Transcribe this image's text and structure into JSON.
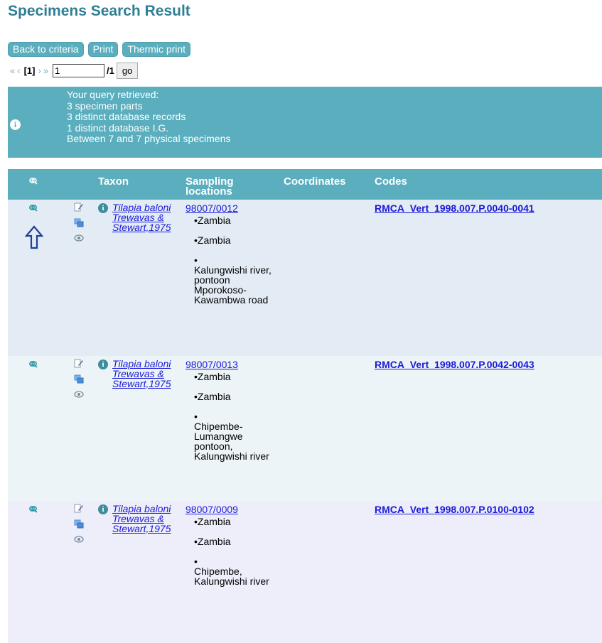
{
  "page": {
    "title": "Specimens Search Result"
  },
  "toolbar": {
    "back_label": "Back to criteria",
    "print_label": "Print",
    "thermic_label": "Thermic print"
  },
  "pager": {
    "first": "«",
    "prev": "‹",
    "current": "[1]",
    "next": "›",
    "last": "»",
    "page_input": "1",
    "total": "/1",
    "go_label": "go"
  },
  "info": {
    "line1": "Your query retrieved:",
    "line2": "3 specimen parts",
    "line3": "3 distinct database records",
    "line4": "1 distinct database I.G.",
    "line5": "Between 7 and 7 physical specimens"
  },
  "table": {
    "headers": {
      "taxon": "Taxon",
      "sampling": "Sampling locations",
      "coordinates": "Coordinates",
      "codes": "Codes"
    },
    "rows": [
      {
        "taxon": "Tilapia baloni Trewavas & Stewart,1975",
        "ig": "98007/0012",
        "loc1": "Zambia",
        "loc2": "Zambia",
        "loc3": "Kalungwishi river, pontoon Mporokoso-Kawambwa road",
        "code": "RMCA_Vert_1998.007.P.0040-0041"
      },
      {
        "taxon": "Tilapia baloni Trewavas & Stewart,1975",
        "ig": "98007/0013",
        "loc1": "Zambia",
        "loc2": "Zambia",
        "loc3": "Chipembe-Lumangwe pontoon, Kalungwishi river",
        "code": "RMCA_Vert_1998.007.P.0042-0043"
      },
      {
        "taxon": "Tilapia baloni Trewavas & Stewart,1975",
        "ig": "98007/0009",
        "loc1": "Zambia",
        "loc2": "Zambia",
        "loc3": "Chipembe, Kalungwishi river",
        "code": "RMCA_Vert_1998.007.P.0100-0102"
      }
    ]
  },
  "icons": {
    "header_magnify": "magnify-icon",
    "row_magnify": "magnify-icon",
    "up_arrow": "up-arrow-icon",
    "edit": "edit-icon",
    "copy": "copy-icon",
    "view": "eye-icon",
    "info": "info-icon"
  },
  "colors": {
    "accent": "#5aaebe",
    "title": "#2e7f95",
    "link": "#1a1ad8",
    "up_arrow": "#1f3f9a"
  }
}
